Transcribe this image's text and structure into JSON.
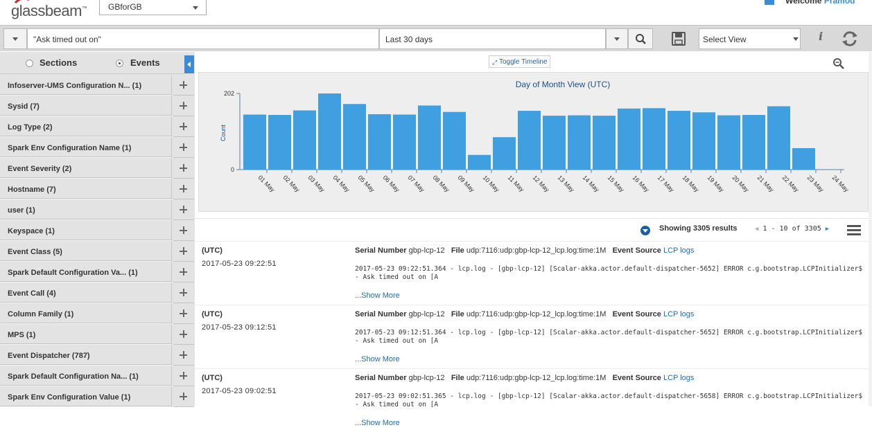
{
  "header": {
    "logo_text": "glassbeam",
    "logo_tm": "™",
    "workspace": "GBforGB",
    "welcome_label": "Welcome",
    "user_name": "Pramod"
  },
  "search": {
    "query": "\"Ask timed out on\"",
    "time_range": "Last 30 days",
    "view_placeholder": "Select View"
  },
  "sidebar": {
    "tabs": [
      {
        "label": "Sections",
        "selected": false
      },
      {
        "label": "Events",
        "selected": true
      }
    ],
    "facets": [
      {
        "label": "Infoserver-UMS Configuration N... (1)"
      },
      {
        "label": "Sysid (7)"
      },
      {
        "label": "Log Type (2)"
      },
      {
        "label": "Spark Env Configuration Name (1)"
      },
      {
        "label": "Event Severity (2)"
      },
      {
        "label": "Hostname (7)"
      },
      {
        "label": "user (1)"
      },
      {
        "label": "Keyspace (1)"
      },
      {
        "label": "Event Class (5)"
      },
      {
        "label": "Spark Default Configuration Va... (1)"
      },
      {
        "label": "Event Call (4)"
      },
      {
        "label": "Column Family (1)"
      },
      {
        "label": "MPS (1)"
      },
      {
        "label": "Event Dispatcher (787)"
      },
      {
        "label": "Spark Default Configuration Na... (1)"
      },
      {
        "label": "Spark Env Configuration Value (1)"
      }
    ]
  },
  "timeline": {
    "toggle_label": "Toggle Timeline"
  },
  "chart_data": {
    "type": "bar",
    "title": "Day of Month View (UTC)",
    "xlabel": "",
    "ylabel": "Count",
    "ylim": [
      0,
      202
    ],
    "yticks": [
      "0",
      "202"
    ],
    "color": "#3f9fe0",
    "categories": [
      "01 May",
      "02 May",
      "03 May",
      "04 May",
      "05 May",
      "06 May",
      "07 May",
      "08 May",
      "09 May",
      "10 May",
      "11 May",
      "12 May",
      "13 May",
      "14 May",
      "15 May",
      "16 May",
      "17 May",
      "18 May",
      "19 May",
      "20 May",
      "21 May",
      "22 May",
      "23 May",
      "24 May"
    ],
    "values": [
      146,
      145,
      157,
      202,
      174,
      147,
      146,
      170,
      153,
      39,
      86,
      156,
      143,
      144,
      143,
      162,
      163,
      156,
      152,
      144,
      145,
      168,
      57,
      0
    ]
  },
  "results": {
    "summary": "Showing 3305 results",
    "pager": "1 - 10 of 3305",
    "items": [
      {
        "tz": "(UTC)",
        "time": "2017-05-23 09:22:51",
        "serial_label": "Serial Number",
        "serial": "gbp-lcp-12",
        "file_label": "File",
        "file": "udp:7116:udp:gbp-lcp-12_lcp.log:time:1M",
        "source_label": "Event Source",
        "source": "LCP logs",
        "log": "2017-05-23 09:22:51.364 - lcp.log - [gbp-lcp-12] [Scalar-akka.actor.default-dispatcher-5652] ERROR c.g.bootstrap.LCPInitializer$ - Ask timed out on [A",
        "more": "...Show More"
      },
      {
        "tz": "(UTC)",
        "time": "2017-05-23 09:12:51",
        "serial_label": "Serial Number",
        "serial": "gbp-lcp-12",
        "file_label": "File",
        "file": "udp:7116:udp:gbp-lcp-12_lcp.log:time:1M",
        "source_label": "Event Source",
        "source": "LCP logs",
        "log": "2017-05-23 09:12:51.364 - lcp.log - [gbp-lcp-12] [Scalar-akka.actor.default-dispatcher-5652] ERROR c.g.bootstrap.LCPInitializer$ - Ask timed out on [A",
        "more": "...Show More"
      },
      {
        "tz": "(UTC)",
        "time": "2017-05-23 09:02:51",
        "serial_label": "Serial Number",
        "serial": "gbp-lcp-12",
        "file_label": "File",
        "file": "udp:7116:udp:gbp-lcp-12_lcp.log:time:1M",
        "source_label": "Event Source",
        "source": "LCP logs",
        "log": "2017-05-23 09:02:51.365 - lcp.log - [gbp-lcp-12] [Scalar-akka.actor.default-dispatcher-5658] ERROR c.g.bootstrap.LCPInitializer$ - Ask timed out on [A",
        "more": "...Show More"
      }
    ]
  }
}
